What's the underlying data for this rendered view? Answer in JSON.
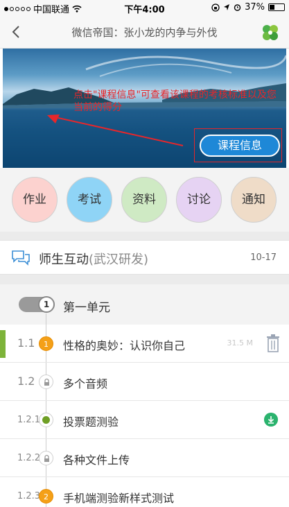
{
  "status_bar": {
    "carrier": "中国联通",
    "time": "下午4:00",
    "battery": "37%",
    "battery_level": 0.37
  },
  "nav": {
    "title": "微信帝国：张小龙的内争与外伐",
    "back_icon": "chevron-left-icon",
    "logo_icon": "clover-logo-icon"
  },
  "banner": {
    "annotation": "点击\"课程信息\"可查看该课程的考核标准以及您当前的得分",
    "course_info_button": "课程信息",
    "accent": "#1e88d7",
    "annotation_color": "#e8262a"
  },
  "menu": [
    {
      "label": "作业",
      "color": "#fcd2cf"
    },
    {
      "label": "考试",
      "color": "#8fd4f6"
    },
    {
      "label": "资料",
      "color": "#cfeac4"
    },
    {
      "label": "讨论",
      "color": "#e6d3f3"
    },
    {
      "label": "通知",
      "color": "#efdcc8"
    }
  ],
  "interaction": {
    "title": "师生互动",
    "subtitle": "(武汉研发)",
    "date": "10-17",
    "icon": "chat-bubbles-icon"
  },
  "unit": {
    "badge": "1",
    "title": "第一单元"
  },
  "items": [
    {
      "num": "1.1",
      "title": "性格的奥妙：认识你自己",
      "marker": "1",
      "marker_type": "orange",
      "size": "31.5 M",
      "action": "trash-icon"
    },
    {
      "num": "1.2",
      "title": "多个音频",
      "marker": "",
      "marker_type": "lock",
      "size": "",
      "action": ""
    },
    {
      "num": "1.2.1",
      "title": "投票题测验",
      "marker": "",
      "marker_type": "greendot",
      "size": "",
      "action": "download-icon"
    },
    {
      "num": "1.2.2",
      "title": "各种文件上传",
      "marker": "",
      "marker_type": "lock",
      "size": "",
      "action": ""
    },
    {
      "num": "1.2.3",
      "title": "手机端测验新样式测试",
      "marker": "2",
      "marker_type": "orange",
      "size": "",
      "action": ""
    }
  ]
}
